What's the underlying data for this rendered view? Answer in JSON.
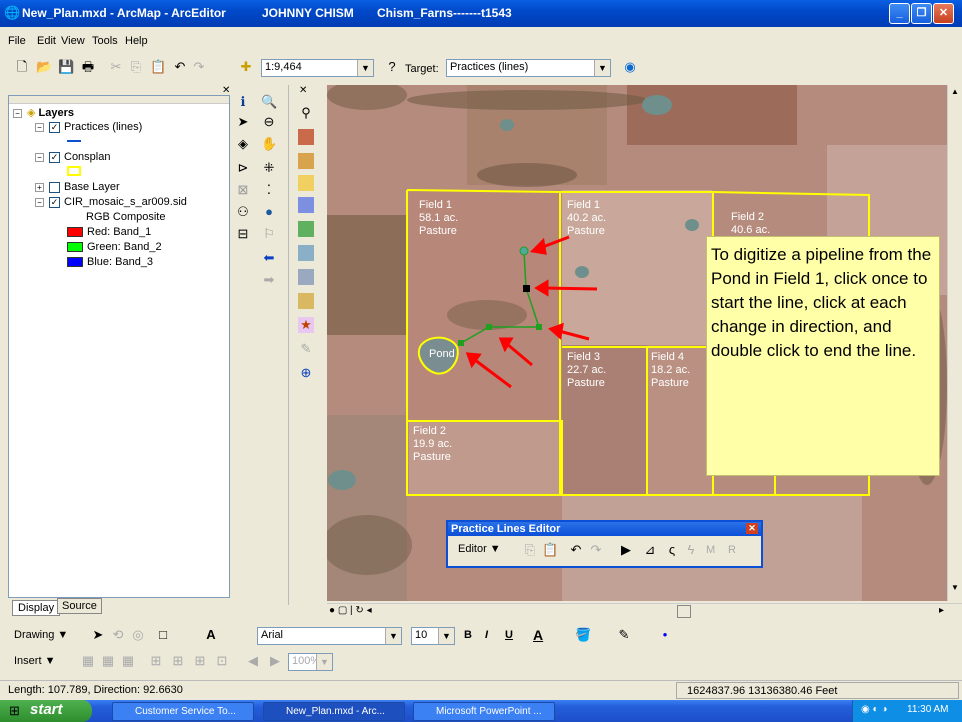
{
  "title": {
    "app": "New_Plan.mxd - ArcMap - ArcEditor",
    "user": "JOHNNY CHISM",
    "farm": "Chism_Farns-------t1543"
  },
  "menu": [
    "File",
    "Edit",
    "View",
    "Tools",
    "Help"
  ],
  "toolbar": {
    "scale": "1:9,464",
    "target_label": "Target:",
    "target_value": "Practices (lines)"
  },
  "toc": {
    "root": "Layers",
    "layers": [
      {
        "name": "Practices (lines)",
        "checked": true
      },
      {
        "name": "Consplan",
        "checked": true
      },
      {
        "name": "Base Layer",
        "checked": false
      },
      {
        "name": "CIR_mosaic_s_ar009.sid",
        "checked": true
      }
    ],
    "rgb_title": "RGB Composite",
    "bands": [
      {
        "label": "Red:   Band_1",
        "color": "#ff0000"
      },
      {
        "label": "Green: Band_2",
        "color": "#00ff00"
      },
      {
        "label": "Blue:  Band_3",
        "color": "#0000ff"
      }
    ],
    "tabs": [
      "Display",
      "Source"
    ]
  },
  "map": {
    "fields": [
      {
        "name": "Field 1",
        "acres": "58.1 ac.",
        "use": "Pasture"
      },
      {
        "name": "Field 1",
        "acres": "40.2 ac.",
        "use": "Pasture"
      },
      {
        "name": "Field 2",
        "acres": "40.6 ac."
      },
      {
        "name": "Field 3",
        "acres": "22.7 ac.",
        "use": "Pasture"
      },
      {
        "name": "Field 4",
        "acres": "18.2 ac.",
        "use": "Pasture"
      },
      {
        "name": "Field 2",
        "acres": "19.9 ac.",
        "use": "Pasture"
      }
    ],
    "pond_label": "Pond",
    "callout": "To digitize a pipeline from the Pond in Field 1, click once to start the line, click at each change in direction, and double click to end the line.",
    "edge_text": "rs"
  },
  "editor_toolbar": {
    "title": "Practice Lines Editor",
    "menu_label": "Editor ▼",
    "m": "M",
    "r": "R"
  },
  "drawing": {
    "drawing_label": "Drawing ▼",
    "font": "Arial",
    "size": "10",
    "bold": "B",
    "italic": "I",
    "underline": "U",
    "font_color_letter": "A",
    "insert_label": "Insert ▼",
    "zoom": "100%"
  },
  "status": {
    "length": "Length: 107.789, Direction: 92.6630",
    "coords": "1624837.96  13136380.46 Feet"
  },
  "taskbar": {
    "start": "start",
    "tasks": [
      "Customer Service To...",
      "New_Plan.mxd - Arc...",
      "Microsoft PowerPoint ..."
    ],
    "clock": "11:30 AM"
  },
  "colors": {
    "boundary": "#ffff00",
    "arrow": "#ff0000",
    "line": "#1fa01f",
    "callout": "#ffffa8"
  }
}
